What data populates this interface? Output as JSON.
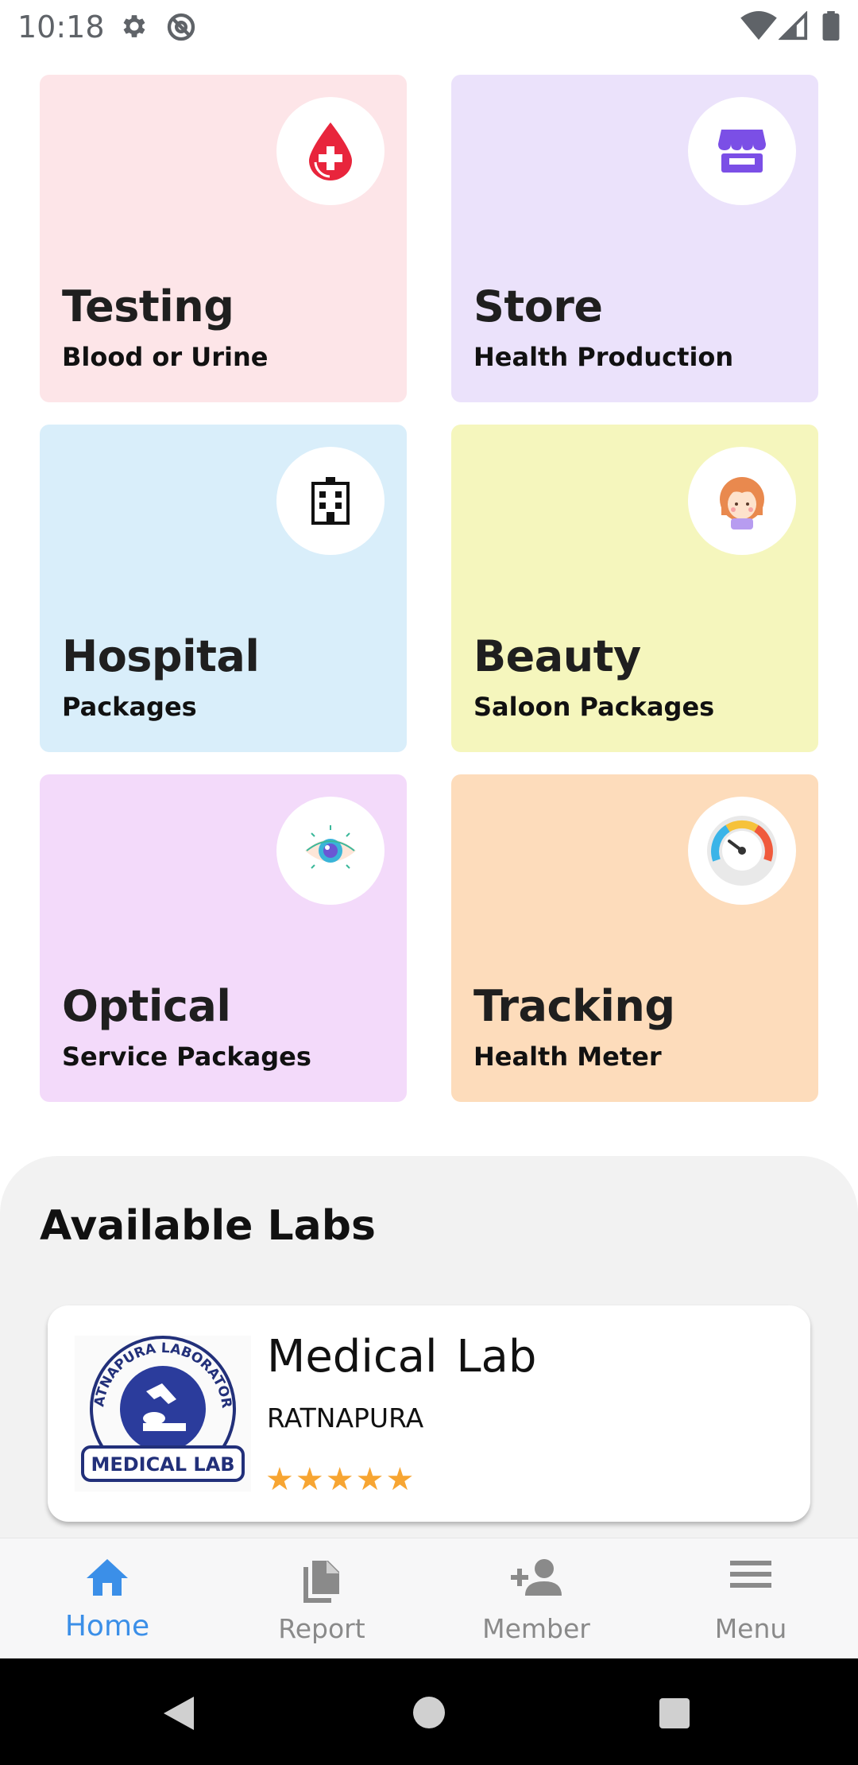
{
  "status_bar": {
    "time": "10:18"
  },
  "services": [
    {
      "title": "Testing",
      "subtitle": "Blood or Urine",
      "bg": "#fde5e8",
      "icon": "blood-drop-icon"
    },
    {
      "title": "Store",
      "subtitle": "Health Production",
      "bg": "#ebe2fb",
      "icon": "store-icon"
    },
    {
      "title": "Hospital",
      "subtitle": "Packages",
      "bg": "#d9eefa",
      "icon": "hospital-building-icon"
    },
    {
      "title": "Beauty",
      "subtitle": "Saloon Packages",
      "bg": "#f5f6bd",
      "icon": "woman-face-icon"
    },
    {
      "title": "Optical",
      "subtitle": "Service Packages",
      "bg": "#f3dafa",
      "icon": "eye-icon"
    },
    {
      "title": "Tracking",
      "subtitle": "Health Meter",
      "bg": "#fddcbb",
      "icon": "gauge-meter-icon"
    }
  ],
  "labs": {
    "heading": "Available Labs",
    "items": [
      {
        "name": "Medical  Lab",
        "city": "RATNAPURA",
        "rating": 5,
        "stars": "★★★★★",
        "logo_text_top": "RATNAPURA LABORATORY",
        "logo_text_bottom": "MEDICAL LAB"
      }
    ]
  },
  "bottom_nav": {
    "items": [
      {
        "label": "Home",
        "icon": "home-icon",
        "active": true
      },
      {
        "label": "Report",
        "icon": "report-icon",
        "active": false
      },
      {
        "label": "Member",
        "icon": "add-member-icon",
        "active": false
      },
      {
        "label": "Menu",
        "icon": "menu-icon",
        "active": false
      }
    ]
  },
  "colors": {
    "accent": "#3b8fe8",
    "star": "#f7a532",
    "labs_bg": "#f2f2f2"
  }
}
